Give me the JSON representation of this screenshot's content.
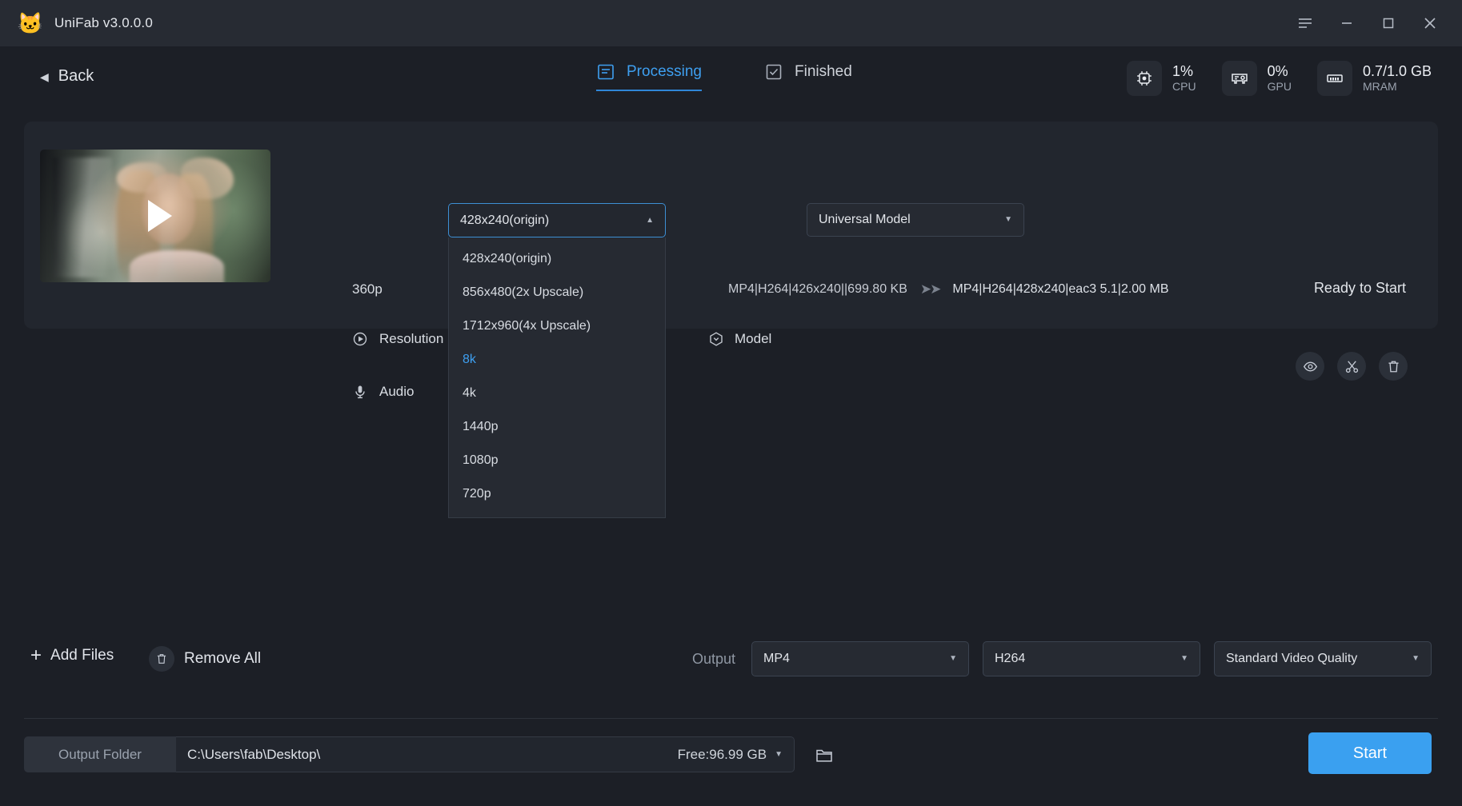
{
  "window": {
    "app_icon": "cat-logo-icon",
    "title": "UniFab v3.0.0.0",
    "controls": {
      "menu": "menu-icon",
      "minimize": "minimize-icon",
      "maximize": "maximize-icon",
      "close": "close-icon"
    }
  },
  "header": {
    "back_label": "Back",
    "tabs": [
      {
        "label": "Processing",
        "icon": "processing-icon",
        "active": true
      },
      {
        "label": "Finished",
        "icon": "finished-check-icon",
        "active": false
      }
    ],
    "stats": [
      {
        "icon": "cpu-icon",
        "value": "1%",
        "label": "CPU"
      },
      {
        "icon": "gpu-icon",
        "value": "0%",
        "label": "GPU"
      },
      {
        "icon": "memory-icon",
        "value": "0.7/1.0 GB",
        "label": "MRAM"
      }
    ]
  },
  "file_card": {
    "thumbnail_alt": "video-thumbnail",
    "source_quality": "360p",
    "source_info": "MP4|H264|426x240||699.80 KB",
    "arrow": "➤➤",
    "target_info": "MP4|H264|428x240|eac3 5.1|2.00 MB",
    "status": "Ready to Start",
    "resolution": {
      "label": "Resolution",
      "icon": "play-circle-icon",
      "value": "428x240(origin)",
      "expanded": true,
      "options": [
        {
          "label": "428x240(origin)",
          "selected": false
        },
        {
          "label": "856x480(2x Upscale)",
          "selected": false
        },
        {
          "label": "1712x960(4x Upscale)",
          "selected": false
        },
        {
          "label": "8k",
          "selected": true
        },
        {
          "label": "4k",
          "selected": false
        },
        {
          "label": "1440p",
          "selected": false
        },
        {
          "label": "1080p",
          "selected": false
        },
        {
          "label": "720p",
          "selected": false
        }
      ]
    },
    "audio": {
      "label": "Audio",
      "icon": "microphone-icon"
    },
    "model": {
      "label": "Model",
      "icon": "model-hex-icon",
      "value": "Universal Model"
    },
    "actions": [
      {
        "icon": "eye-icon",
        "name": "preview"
      },
      {
        "icon": "scissors-icon",
        "name": "trim"
      },
      {
        "icon": "trash-icon",
        "name": "delete"
      }
    ]
  },
  "footer": {
    "add_files_label": "Add Files",
    "remove_all_label": "Remove All",
    "output_label": "Output",
    "output_format": "MP4",
    "output_codec": "H264",
    "output_quality": "Standard Video Quality",
    "output_folder_label": "Output Folder",
    "output_folder_path": "C:\\Users\\fab\\Desktop\\",
    "free_space": "Free:96.99 GB",
    "folder_browse_icon": "folder-icon",
    "start_label": "Start"
  },
  "colors": {
    "accent": "#3aa0f0",
    "tab_active": "#3e9ff0",
    "window_bg": "#1c1f26",
    "card_bg": "#22262e"
  }
}
